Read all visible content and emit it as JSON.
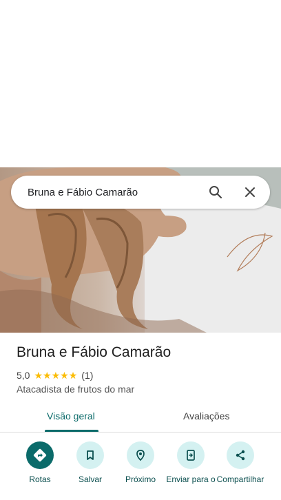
{
  "search": {
    "query": "Bruna e Fábio Camarão"
  },
  "place": {
    "name": "Bruna e Fábio Camarão",
    "rating": "5,0",
    "stars_filled": 5,
    "review_count": "(1)",
    "category": "Atacadista de frutos do mar"
  },
  "tabs": [
    {
      "label": "Visão geral",
      "selected": true
    },
    {
      "label": "Avaliações",
      "selected": false
    }
  ],
  "actions": [
    {
      "label": "Rotas",
      "icon": "directions-icon"
    },
    {
      "label": "Salvar",
      "icon": "bookmark-icon"
    },
    {
      "label": "Próximo",
      "icon": "nearby-icon"
    },
    {
      "label": "Enviar para o",
      "icon": "send-to-phone-icon"
    },
    {
      "label": "Compartilhar",
      "icon": "share-icon"
    }
  ],
  "colors": {
    "accent": "#0b6b6a",
    "accent_light": "#d4f1f1",
    "star": "#fbbc04"
  }
}
